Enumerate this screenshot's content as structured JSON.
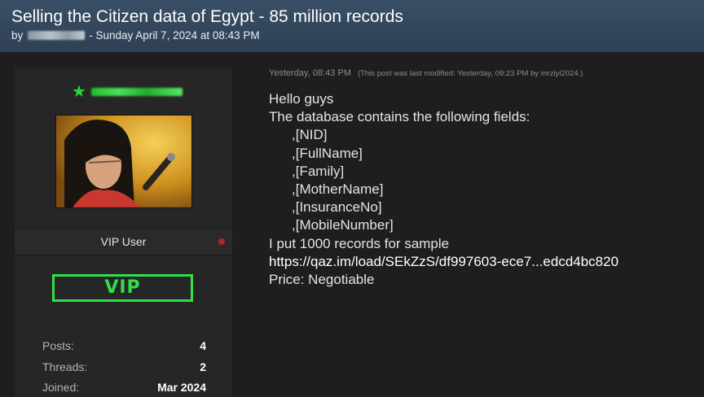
{
  "thread": {
    "title": "Selling the Citizen data of Egypt - 85 million records",
    "by_prefix": "by",
    "date_text": "- Sunday April 7, 2024 at 08:43 PM"
  },
  "author": {
    "role": "VIP User",
    "badge": "VIP",
    "stats": [
      {
        "label": "Posts:",
        "value": "4"
      },
      {
        "label": "Threads:",
        "value": "2"
      },
      {
        "label": "Joined:",
        "value": "Mar 2024"
      }
    ]
  },
  "post": {
    "time": "Yesterday, 08:43 PM",
    "modified": "(This post was last modified: Yesterday, 09:23 PM by mrziyi2024.)",
    "lines": {
      "greeting": "Hello guys",
      "intro": "The database contains the following fields:",
      "fields": [
        ",[NID]",
        ",[FullName]",
        ",[Family]",
        ",[MotherName]",
        ",[InsuranceNo]",
        ",[MobileNumber]"
      ],
      "sample": "I put 1000 records for sample",
      "link": "https://qaz.im/load/SEkZzS/df997603-ece7...edcd4bc820",
      "price": "Price: Negotiable"
    }
  },
  "colors": {
    "header_bg": "#34485e",
    "page_bg": "#1e1e1e",
    "vip_green": "#2fe04a",
    "status_dot": "#b02424"
  },
  "icons": {
    "username_star": "star-icon",
    "status": "offline-status-dot"
  }
}
